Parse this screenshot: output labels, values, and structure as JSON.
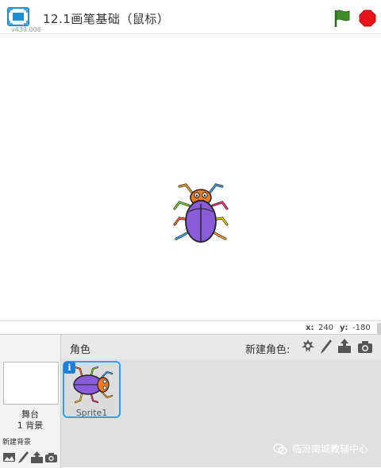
{
  "header": {
    "title": "12.1画笔基础（鼠标）",
    "version": "v439.006",
    "icons": {
      "fullscreen": "fullscreen-icon",
      "go": "green-flag-icon",
      "stop": "stop-sign-icon"
    }
  },
  "stage_info": {
    "x_label": "x:",
    "x_value": "240",
    "y_label": "y:",
    "y_value": "-180"
  },
  "sprites_pane": {
    "label": "角色",
    "new_sprite_label": "新建角色:",
    "new_sprite_icons": [
      "sprite-library-icon",
      "paint-brush-icon",
      "upload-icon",
      "camera-icon"
    ],
    "sprites": [
      {
        "name": "Sprite1",
        "info": "i"
      }
    ]
  },
  "stage_pane": {
    "name": "舞台",
    "backdrop_count": "1 背景",
    "new_backdrop_label": "新建背景",
    "new_backdrop_icons": [
      "backdrop-library-icon",
      "paint-brush-icon",
      "upload-icon",
      "camera-icon"
    ]
  },
  "watermark": "临汾南城教辅中心",
  "colors": {
    "accent_blue": "#2da0e6",
    "flag_green": "#3f8c2a",
    "stop_red": "#e8141b",
    "beetle_purple": "#8a5bd6",
    "beetle_orange": "#f07a1c"
  }
}
